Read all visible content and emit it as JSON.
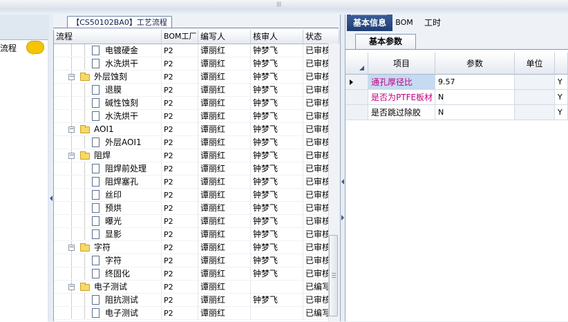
{
  "window": {
    "doc_tab_title": "【CS50102BA0】工艺流程",
    "left_panel_label": "流程"
  },
  "tree_grid": {
    "columns": [
      "流程",
      "BOM工厂",
      "编写人",
      "核审人",
      "状态"
    ],
    "rows": [
      {
        "level": 2,
        "type": "doc",
        "label": "电镀硬金",
        "bom": "P2",
        "editor": "谭丽红",
        "reviewer": "钟梦飞",
        "status": "已审核"
      },
      {
        "level": 2,
        "type": "doc",
        "label": "水洗烘干",
        "bom": "P2",
        "editor": "谭丽红",
        "reviewer": "钟梦飞",
        "status": "已审核"
      },
      {
        "level": 1,
        "type": "folder",
        "label": "外层蚀刻",
        "bom": "P2",
        "editor": "谭丽红",
        "reviewer": "钟梦飞",
        "status": "已审核"
      },
      {
        "level": 2,
        "type": "doc",
        "label": "退膜",
        "bom": "P2",
        "editor": "谭丽红",
        "reviewer": "钟梦飞",
        "status": "已审核"
      },
      {
        "level": 2,
        "type": "doc",
        "label": "碱性蚀刻",
        "bom": "P2",
        "editor": "谭丽红",
        "reviewer": "钟梦飞",
        "status": "已审核"
      },
      {
        "level": 2,
        "type": "doc",
        "label": "水洗烘干",
        "bom": "P2",
        "editor": "谭丽红",
        "reviewer": "钟梦飞",
        "status": "已审核"
      },
      {
        "level": 1,
        "type": "folder",
        "label": "AOI1",
        "bom": "P2",
        "editor": "谭丽红",
        "reviewer": "钟梦飞",
        "status": "已审核"
      },
      {
        "level": 2,
        "type": "doc",
        "label": "外层AOI1",
        "bom": "P2",
        "editor": "谭丽红",
        "reviewer": "钟梦飞",
        "status": "已审核"
      },
      {
        "level": 1,
        "type": "folder",
        "label": "阻焊",
        "bom": "P2",
        "editor": "谭丽红",
        "reviewer": "钟梦飞",
        "status": "已审核"
      },
      {
        "level": 2,
        "type": "doc",
        "label": "阻焊前处理",
        "bom": "P2",
        "editor": "谭丽红",
        "reviewer": "钟梦飞",
        "status": "已审核"
      },
      {
        "level": 2,
        "type": "doc",
        "label": "阻焊塞孔",
        "bom": "P2",
        "editor": "谭丽红",
        "reviewer": "钟梦飞",
        "status": "已审核"
      },
      {
        "level": 2,
        "type": "doc",
        "label": "丝印",
        "bom": "P2",
        "editor": "谭丽红",
        "reviewer": "钟梦飞",
        "status": "已审核"
      },
      {
        "level": 2,
        "type": "doc",
        "label": "预烘",
        "bom": "P2",
        "editor": "谭丽红",
        "reviewer": "钟梦飞",
        "status": "已审核"
      },
      {
        "level": 2,
        "type": "doc",
        "label": "曝光",
        "bom": "P2",
        "editor": "谭丽红",
        "reviewer": "钟梦飞",
        "status": "已审核"
      },
      {
        "level": 2,
        "type": "doc",
        "label": "显影",
        "bom": "P2",
        "editor": "谭丽红",
        "reviewer": "钟梦飞",
        "status": "已审核"
      },
      {
        "level": 1,
        "type": "folder",
        "label": "字符",
        "bom": "P2",
        "editor": "谭丽红",
        "reviewer": "钟梦飞",
        "status": "已审核"
      },
      {
        "level": 2,
        "type": "doc",
        "label": "字符",
        "bom": "P2",
        "editor": "谭丽红",
        "reviewer": "钟梦飞",
        "status": "已审核"
      },
      {
        "level": 2,
        "type": "doc",
        "label": "终固化",
        "bom": "P2",
        "editor": "谭丽红",
        "reviewer": "钟梦飞",
        "status": "已审核"
      },
      {
        "level": 1,
        "type": "folder",
        "label": "电子测试",
        "bom": "P2",
        "editor": "谭丽红",
        "reviewer": "",
        "status": "已编写"
      },
      {
        "level": 2,
        "type": "doc",
        "label": "阻抗测试",
        "bom": "P2",
        "editor": "谭丽红",
        "reviewer": "钟梦飞",
        "status": "已审核"
      },
      {
        "level": 2,
        "type": "doc",
        "label": "电子测试",
        "bom": "P2",
        "editor": "谭丽红",
        "reviewer": "",
        "status": "已编写"
      }
    ]
  },
  "right_panel": {
    "tabs": [
      "基本信息",
      "BOM",
      "工时"
    ],
    "active_tab": "基本信息",
    "subtab": "基本参数",
    "param_columns": [
      "项目",
      "参数",
      "单位"
    ],
    "params": [
      {
        "name": "通孔厚径比",
        "value": "9.57",
        "unit": "",
        "flag": "Y",
        "name_color": "#c0007f",
        "selected": true
      },
      {
        "name": "是否为PTFE板材",
        "value": "N",
        "unit": "",
        "flag": "Y",
        "name_color": "#c0007f",
        "selected": false
      },
      {
        "name": "是否跳过除胶",
        "value": "N",
        "unit": "",
        "flag": "Y",
        "name_color": "#000000",
        "selected": false
      }
    ]
  }
}
